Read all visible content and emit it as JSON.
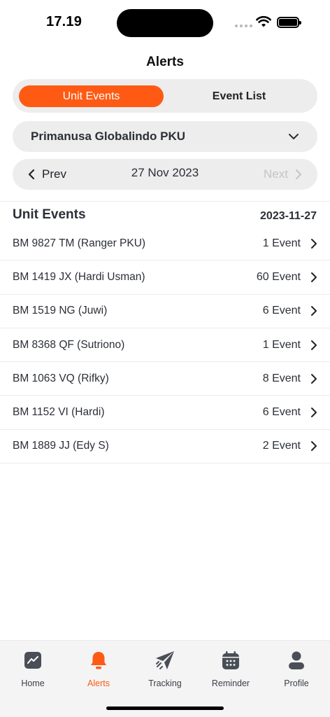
{
  "status_bar": {
    "time": "17.19"
  },
  "header": {
    "title": "Alerts"
  },
  "segment": {
    "unit_events": "Unit Events",
    "event_list": "Event List"
  },
  "company": {
    "selected": "Primanusa Globalindo PKU"
  },
  "date_nav": {
    "prev": "Prev",
    "date": "27 Nov 2023",
    "next": "Next"
  },
  "list": {
    "title": "Unit Events",
    "date": "2023-11-27",
    "rows": [
      {
        "name": "BM 9827 TM (Ranger PKU)",
        "count": "1 Event"
      },
      {
        "name": "BM 1419 JX (Hardi Usman)",
        "count": "60 Event"
      },
      {
        "name": "BM 1519 NG (Juwi)",
        "count": "6 Event"
      },
      {
        "name": "BM 8368 QF (Sutriono)",
        "count": "1 Event"
      },
      {
        "name": "BM 1063 VQ (Rifky)",
        "count": "8 Event"
      },
      {
        "name": "BM 1152 VI (Hardi)",
        "count": "6 Event"
      },
      {
        "name": "BM 1889 JJ (Edy S)",
        "count": "2 Event"
      }
    ]
  },
  "tabs": [
    {
      "label": "Home",
      "icon": "chart-icon"
    },
    {
      "label": "Alerts",
      "icon": "bell-icon"
    },
    {
      "label": "Tracking",
      "icon": "paper-plane-icon"
    },
    {
      "label": "Reminder",
      "icon": "calendar-icon"
    },
    {
      "label": "Profile",
      "icon": "user-icon"
    }
  ],
  "colors": {
    "accent": "#ff5a14",
    "pill": "#ededed",
    "text": "#2b2f36"
  }
}
